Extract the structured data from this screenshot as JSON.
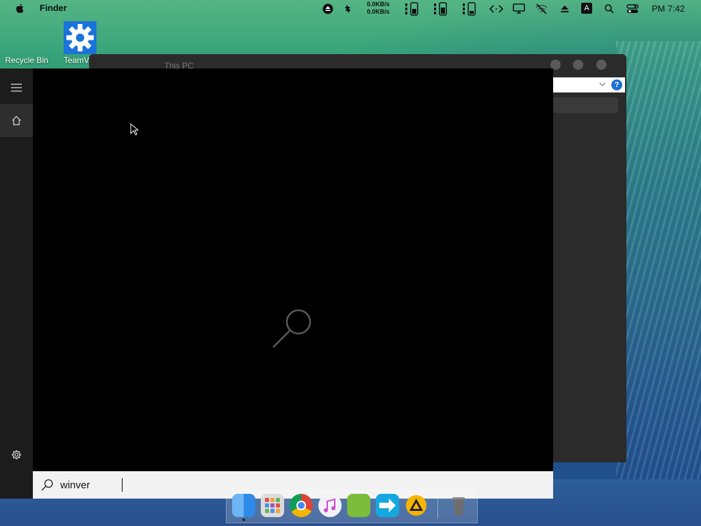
{
  "menubar": {
    "app_name": "Finder",
    "net_up": "0.0KB/s",
    "net_down": "0.0KB/s",
    "input_badge": "A",
    "clock": "PM 7:42"
  },
  "desktop": {
    "icons": [
      {
        "label": "Recycle Bin"
      },
      {
        "label": "TeamV"
      }
    ]
  },
  "explorer": {
    "title": "This PC",
    "help": "?"
  },
  "search": {
    "query": "winver"
  },
  "colors": {
    "flyout_bg": "#000000",
    "nav_bg": "#1c1c1c",
    "searchbox_bg": "#f2f2f2"
  }
}
